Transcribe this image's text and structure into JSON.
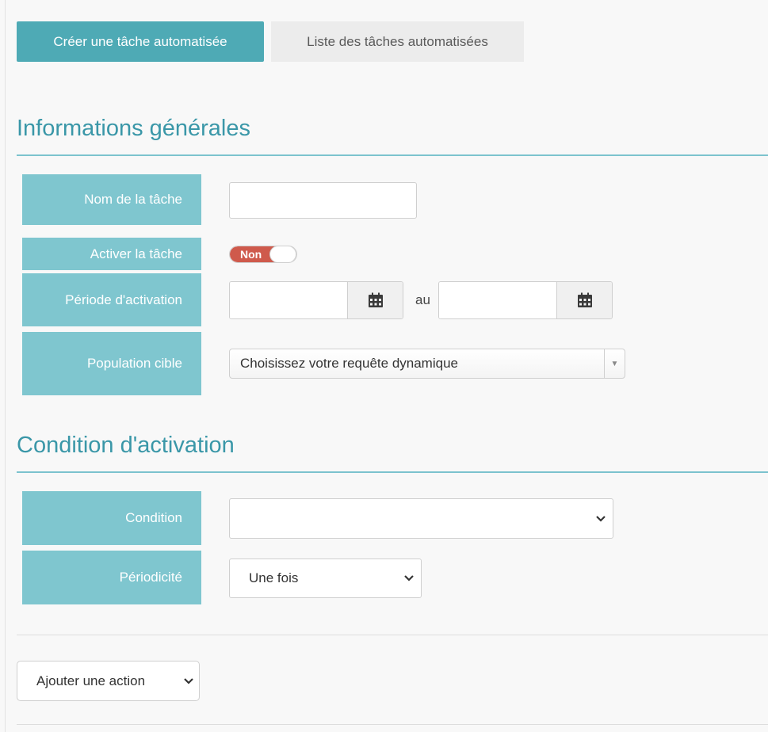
{
  "tabs": {
    "active": "Créer une tâche automatisée",
    "inactive": "Liste des tâches automatisées"
  },
  "sections": {
    "general": "Informations générales",
    "activation": "Condition d'activation"
  },
  "fields": {
    "task_name": {
      "label": "Nom de la tâche",
      "value": ""
    },
    "activate": {
      "label": "Activer la tâche",
      "toggle_text": "Non"
    },
    "period": {
      "label": "Période d'activation",
      "separator": "au",
      "start": "",
      "end": ""
    },
    "population": {
      "label": "Population cible",
      "selected": "Choisissez votre requête dynamique"
    },
    "condition": {
      "label": "Condition",
      "selected": ""
    },
    "periodicity": {
      "label": "Périodicité",
      "selected": "Une fois"
    }
  },
  "add_action": {
    "selected": "Ajouter une action"
  },
  "colors": {
    "accent": "#4eaab5",
    "label_bg": "#7fc6cf",
    "title": "#3a97a8",
    "toggle_off": "#cf5a4c"
  },
  "icons": {
    "calendar": "calendar-icon",
    "chevron": "chevron-down-icon",
    "caret": "caret-down-icon"
  }
}
